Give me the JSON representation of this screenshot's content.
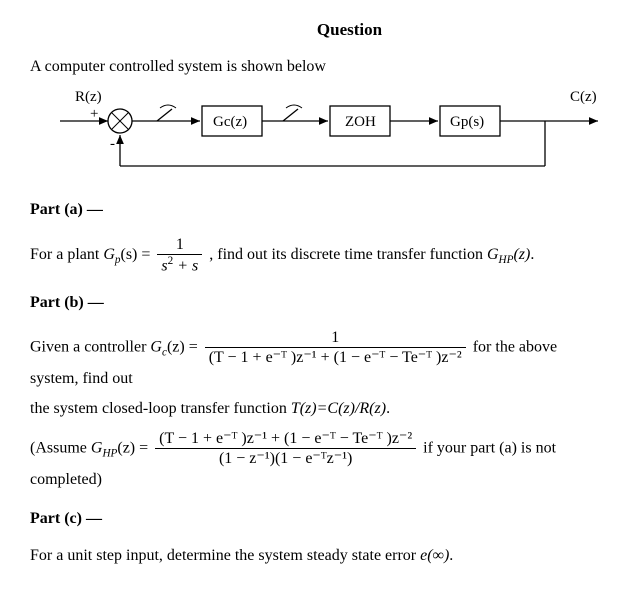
{
  "title": "Question",
  "intro": "A computer controlled system is shown below",
  "diagram": {
    "input": "R(z)",
    "output": "C(z)",
    "plus": "+",
    "minus": "-",
    "block1": "Gc(z)",
    "block2": "ZOH",
    "block3": "Gp(s)"
  },
  "partA": {
    "heading": "Part (a) —",
    "pre": "For a plant ",
    "gp_lhs": "G",
    "gp_sub": "p",
    "gp_arg": "(s) =",
    "frac_num": "1",
    "frac_den_s2": "s",
    "frac_den_exp": "2",
    "frac_den_tail": " + s",
    "after": ", find out its discrete time transfer function ",
    "ghp": "G",
    "ghp_sub": "HP",
    "ghp_arg": "(z)",
    "period": "."
  },
  "partB": {
    "heading": "Part (b) —",
    "pre": "Given a controller ",
    "gc": "G",
    "gc_sub": "c",
    "gc_arg": "(z) =",
    "frac1_num": "1",
    "frac1_den": "(T − 1 + e⁻ᵀ )z⁻¹ + (1 − e⁻ᵀ − Te⁻ᵀ )z⁻²",
    "after1": " for the above system, find out",
    "line2": "the system closed-loop transfer function ",
    "tz": "T(z)=C(z)/R(z)",
    "period2": ".",
    "assume_pre": "(Assume ",
    "ghp2": "G",
    "ghp2_sub": "HP",
    "ghp2_arg": "(z) =",
    "frac2_num": "(T − 1 + e⁻ᵀ )z⁻¹ + (1 − e⁻ᵀ − Te⁻ᵀ )z⁻²",
    "frac2_den": "(1 − z⁻¹)(1 − e⁻ᵀz⁻¹)",
    "assume_post": " if your part (a) is not completed)"
  },
  "partC": {
    "heading": "Part (c) —",
    "text_pre": "For a unit step input, determine the system steady state error ",
    "einf": "e(∞)",
    "period": "."
  }
}
